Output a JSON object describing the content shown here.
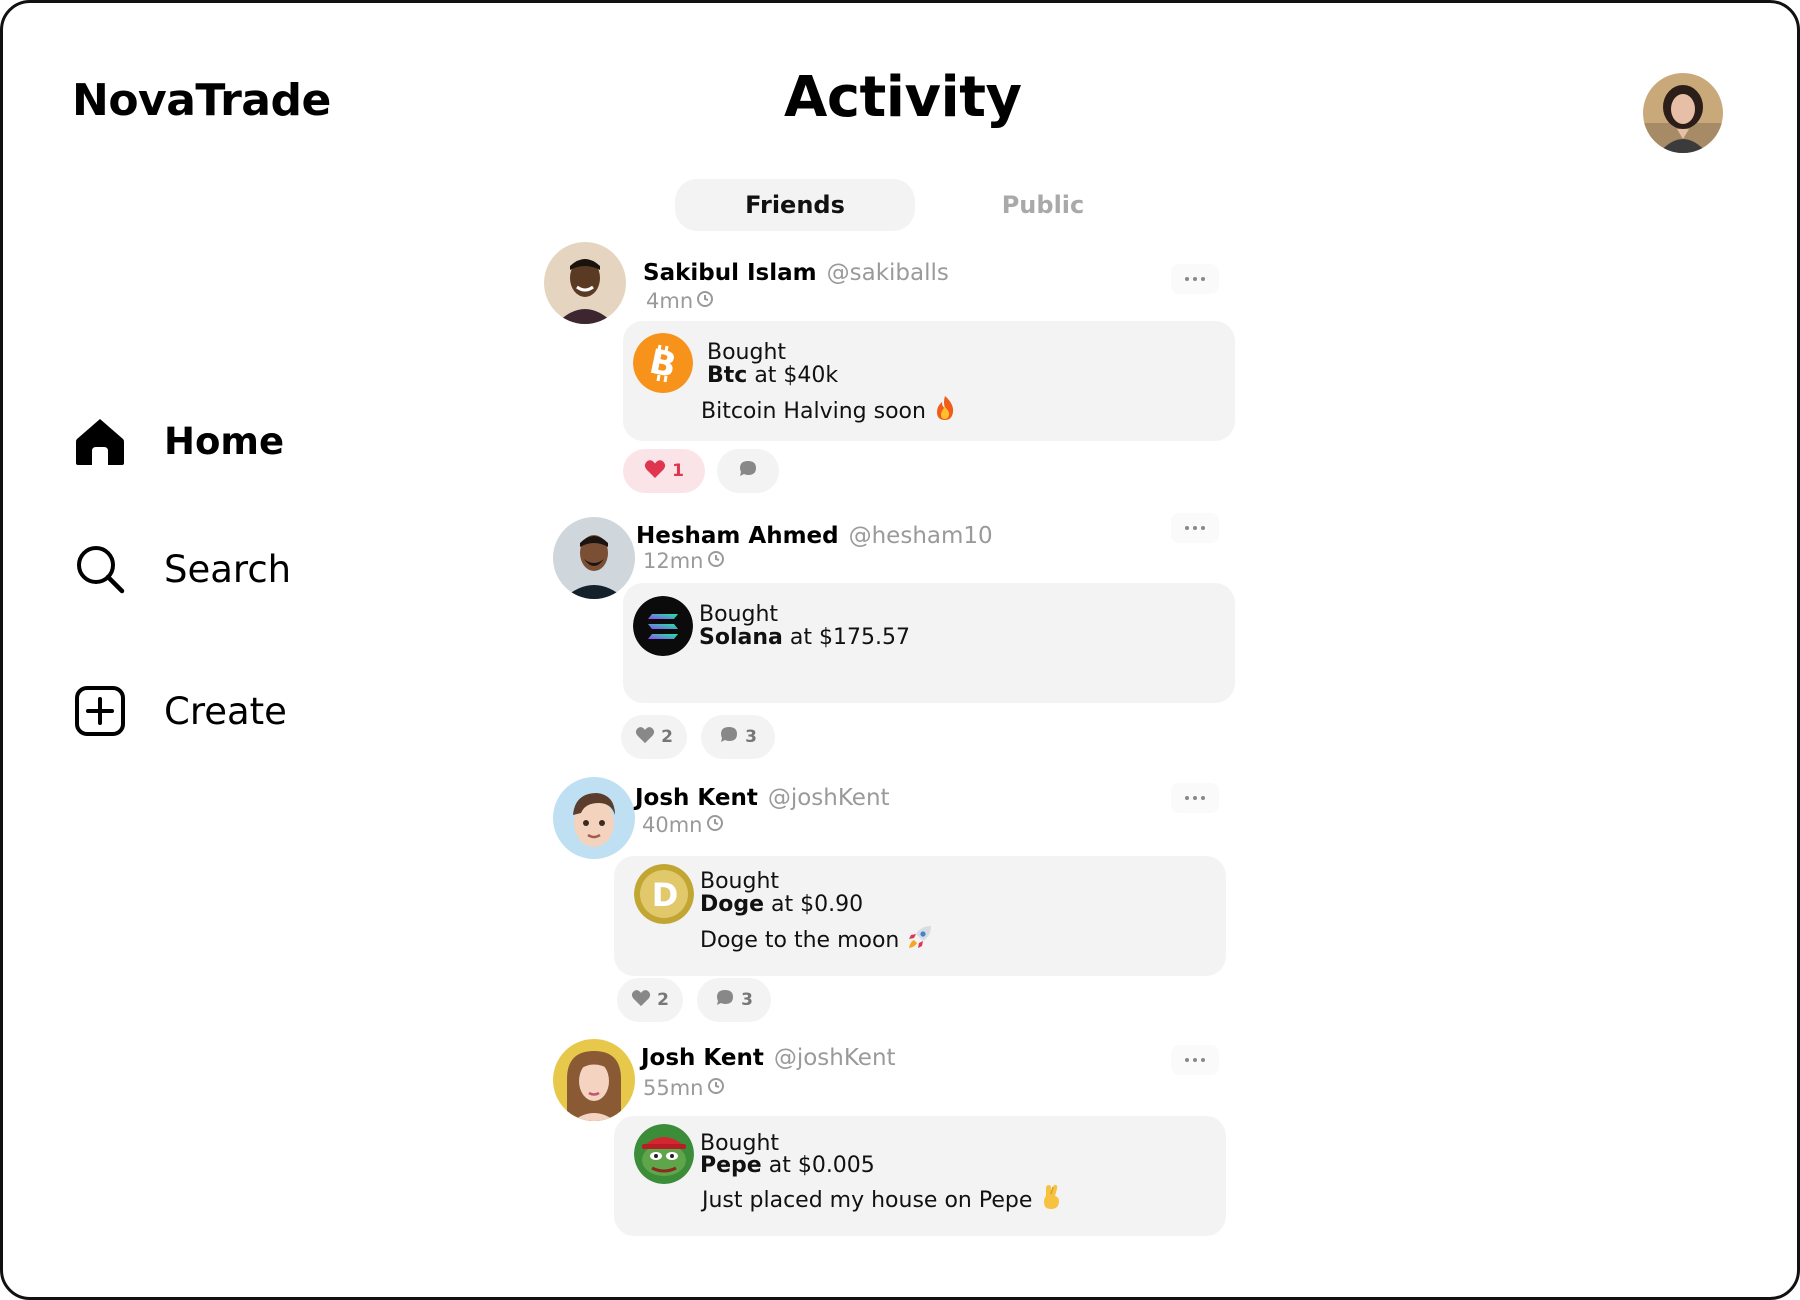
{
  "app": {
    "brand": "NovaTrade",
    "title": "Activity"
  },
  "sidebar": {
    "items": [
      {
        "label": "Home",
        "icon": "home-icon"
      },
      {
        "label": "Search",
        "icon": "search-icon"
      },
      {
        "label": "Create",
        "icon": "plus-square-icon"
      }
    ]
  },
  "tabs": [
    {
      "label": "Friends",
      "active": true
    },
    {
      "label": "Public",
      "active": false
    }
  ],
  "colors": {
    "like_active": "#e0354f",
    "card_bg": "#f3f3f3",
    "muted": "#9a9a9a"
  },
  "posts": [
    {
      "name": "Sakibul Islam",
      "handle": "@sakiballs",
      "time": "4mn",
      "bought_label": "Bought",
      "coin": "Btc",
      "price": "at $40k",
      "text": "Bitcoin Halving soon",
      "emoji": "fire",
      "likes": "1",
      "comments": "",
      "liked": true,
      "coin_icon": "bitcoin-icon"
    },
    {
      "name": "Hesham Ahmed",
      "handle": "@hesham10",
      "time": "12mn",
      "bought_label": "Bought",
      "coin": "Solana",
      "price": "at $175.57",
      "text": "",
      "emoji": "",
      "likes": "2",
      "comments": "3",
      "liked": false,
      "coin_icon": "solana-icon"
    },
    {
      "name": "Josh Kent",
      "handle": "@joshKent",
      "time": "40mn",
      "bought_label": "Bought",
      "coin": "Doge",
      "price": "at $0.90",
      "text": "Doge to the moon",
      "emoji": "rocket",
      "likes": "2",
      "comments": "3",
      "liked": false,
      "coin_icon": "dogecoin-icon"
    },
    {
      "name": "Josh Kent",
      "handle": "@joshKent",
      "time": "55mn",
      "bought_label": "Bought",
      "coin": "Pepe",
      "price": "at $0.005",
      "text": "Just placed my house on Pepe",
      "emoji": "crossed-fingers",
      "likes": "",
      "comments": "",
      "liked": false,
      "coin_icon": "pepe-icon"
    }
  ]
}
